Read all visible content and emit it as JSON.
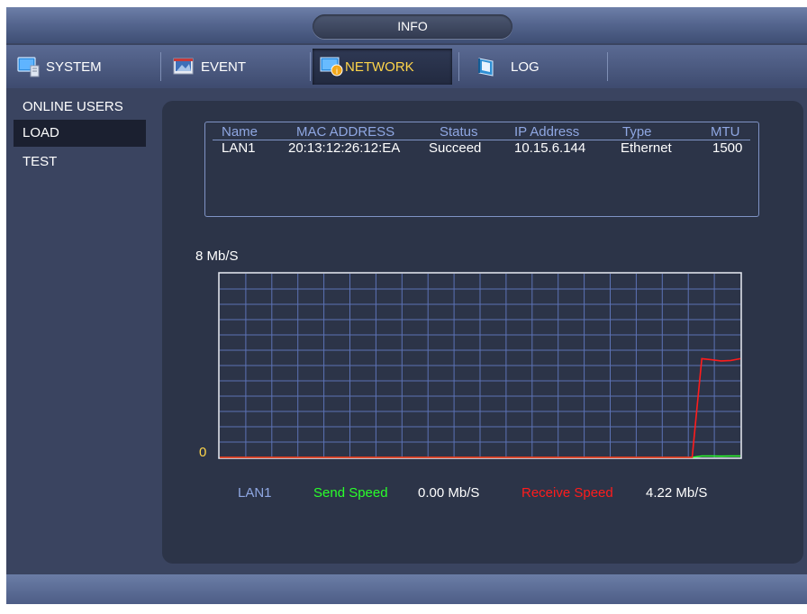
{
  "window": {
    "title": "INFO"
  },
  "tabs": [
    {
      "label": "SYSTEM",
      "icon": "monitor-icon"
    },
    {
      "label": "EVENT",
      "icon": "event-icon"
    },
    {
      "label": "NETWORK",
      "icon": "network-icon",
      "active": true
    },
    {
      "label": "LOG",
      "icon": "log-book-icon"
    }
  ],
  "sidebar": {
    "items": [
      {
        "label": "ONLINE USERS"
      },
      {
        "label": "LOAD",
        "active": true
      },
      {
        "label": "TEST"
      }
    ]
  },
  "interface_table": {
    "headers": [
      "Name",
      "MAC ADDRESS",
      "Status",
      "IP Address",
      "Type",
      "MTU"
    ],
    "rows": [
      [
        "LAN1",
        "20:13:12:26:12:EA",
        "Succeed",
        "10.15.6.144",
        "Ethernet",
        "1500"
      ]
    ]
  },
  "chart": {
    "y_max_label": "8 Mb/S",
    "y_min_label": "0",
    "legend": {
      "interface": "LAN1",
      "send_label": "Send Speed",
      "send_value": "0.00 Mb/S",
      "receive_label": "Receive Speed",
      "receive_value": "4.22 Mb/S"
    }
  },
  "chart_data": {
    "type": "line",
    "ylim": [
      0,
      8
    ],
    "unit": "Mb/S",
    "grid": true,
    "series": [
      {
        "name": "Send Speed",
        "color": "#2aff2a",
        "values": [
          0,
          0,
          0,
          0,
          0,
          0,
          0,
          0,
          0,
          0,
          0,
          0,
          0,
          0,
          0,
          0,
          0,
          0,
          0,
          0,
          0,
          0,
          0,
          0,
          0,
          0,
          0,
          0,
          0,
          0,
          0,
          0,
          0,
          0,
          0,
          0,
          0,
          0,
          0,
          0,
          0,
          0,
          0,
          0,
          0,
          0,
          0,
          0,
          0,
          0,
          0.06,
          0.06,
          0.05,
          0.06,
          0.06
        ]
      },
      {
        "name": "Receive Speed",
        "color": "#ff1c1c",
        "values": [
          0,
          0,
          0,
          0,
          0,
          0,
          0,
          0,
          0,
          0,
          0,
          0,
          0,
          0,
          0,
          0,
          0,
          0,
          0,
          0,
          0,
          0,
          0,
          0,
          0,
          0,
          0,
          0,
          0,
          0,
          0,
          0,
          0,
          0,
          0,
          0,
          0,
          0,
          0,
          0,
          0,
          0,
          0,
          0,
          0,
          0,
          0,
          0,
          0,
          0,
          4.3,
          4.25,
          4.2,
          4.22,
          4.3
        ]
      }
    ]
  },
  "colors": {
    "accent_active_tab": "#ffd64a",
    "header_text": "#8fa7e2",
    "send": "#2aff2a",
    "receive": "#ff1c1c",
    "grid": "#5c72b5"
  }
}
